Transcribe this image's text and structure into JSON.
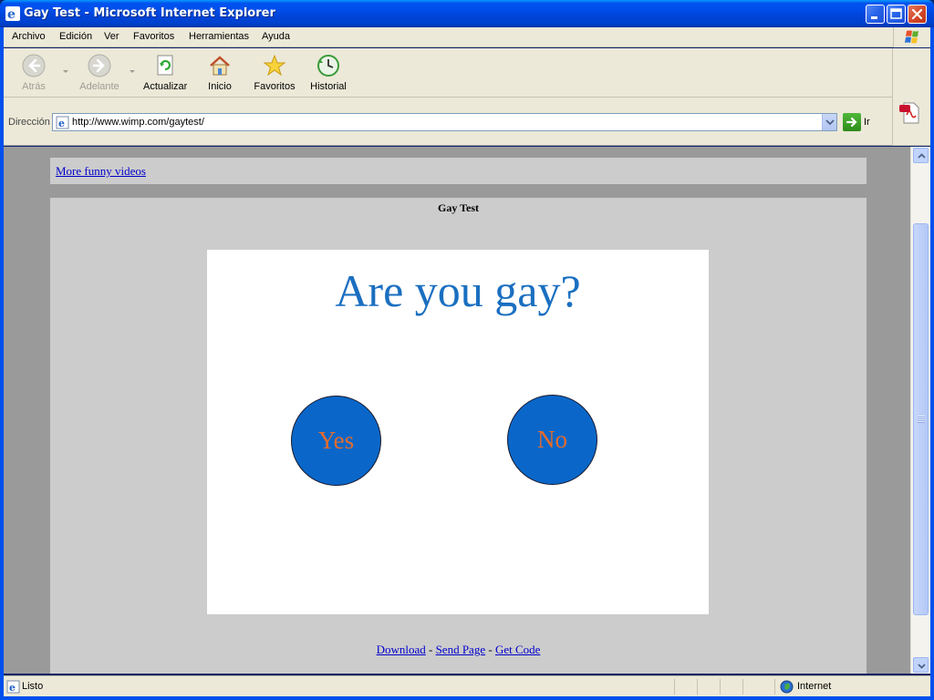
{
  "window": {
    "title": "Gay Test - Microsoft Internet Explorer"
  },
  "menu": {
    "items": [
      "Archivo",
      "Edición",
      "Ver",
      "Favoritos",
      "Herramientas",
      "Ayuda"
    ]
  },
  "toolbar": {
    "back_label": "Atrás",
    "forward_label": "Adelante",
    "refresh_label": "Actualizar",
    "home_label": "Inicio",
    "favorites_label": "Favoritos",
    "history_label": "Historial"
  },
  "address": {
    "label": "Dirección",
    "url": "http://www.wimp.com/gaytest/",
    "go_label": "Ir"
  },
  "page": {
    "top_link": "More funny videos",
    "heading": "Gay Test",
    "question": "Are you gay?",
    "yes_label": "Yes",
    "no_label": "No",
    "footer": {
      "download": "Download",
      "send_page": "Send Page",
      "get_code": "Get Code",
      "separator": " - "
    }
  },
  "status": {
    "text": "Listo",
    "zone": "Internet"
  },
  "colors": {
    "titlebar": "#0050ee",
    "chrome": "#ece9d8",
    "question_text": "#1a6fc0",
    "circle_fill": "#0a67c9",
    "circle_text": "#e56b2c",
    "link": "#0000cc"
  }
}
